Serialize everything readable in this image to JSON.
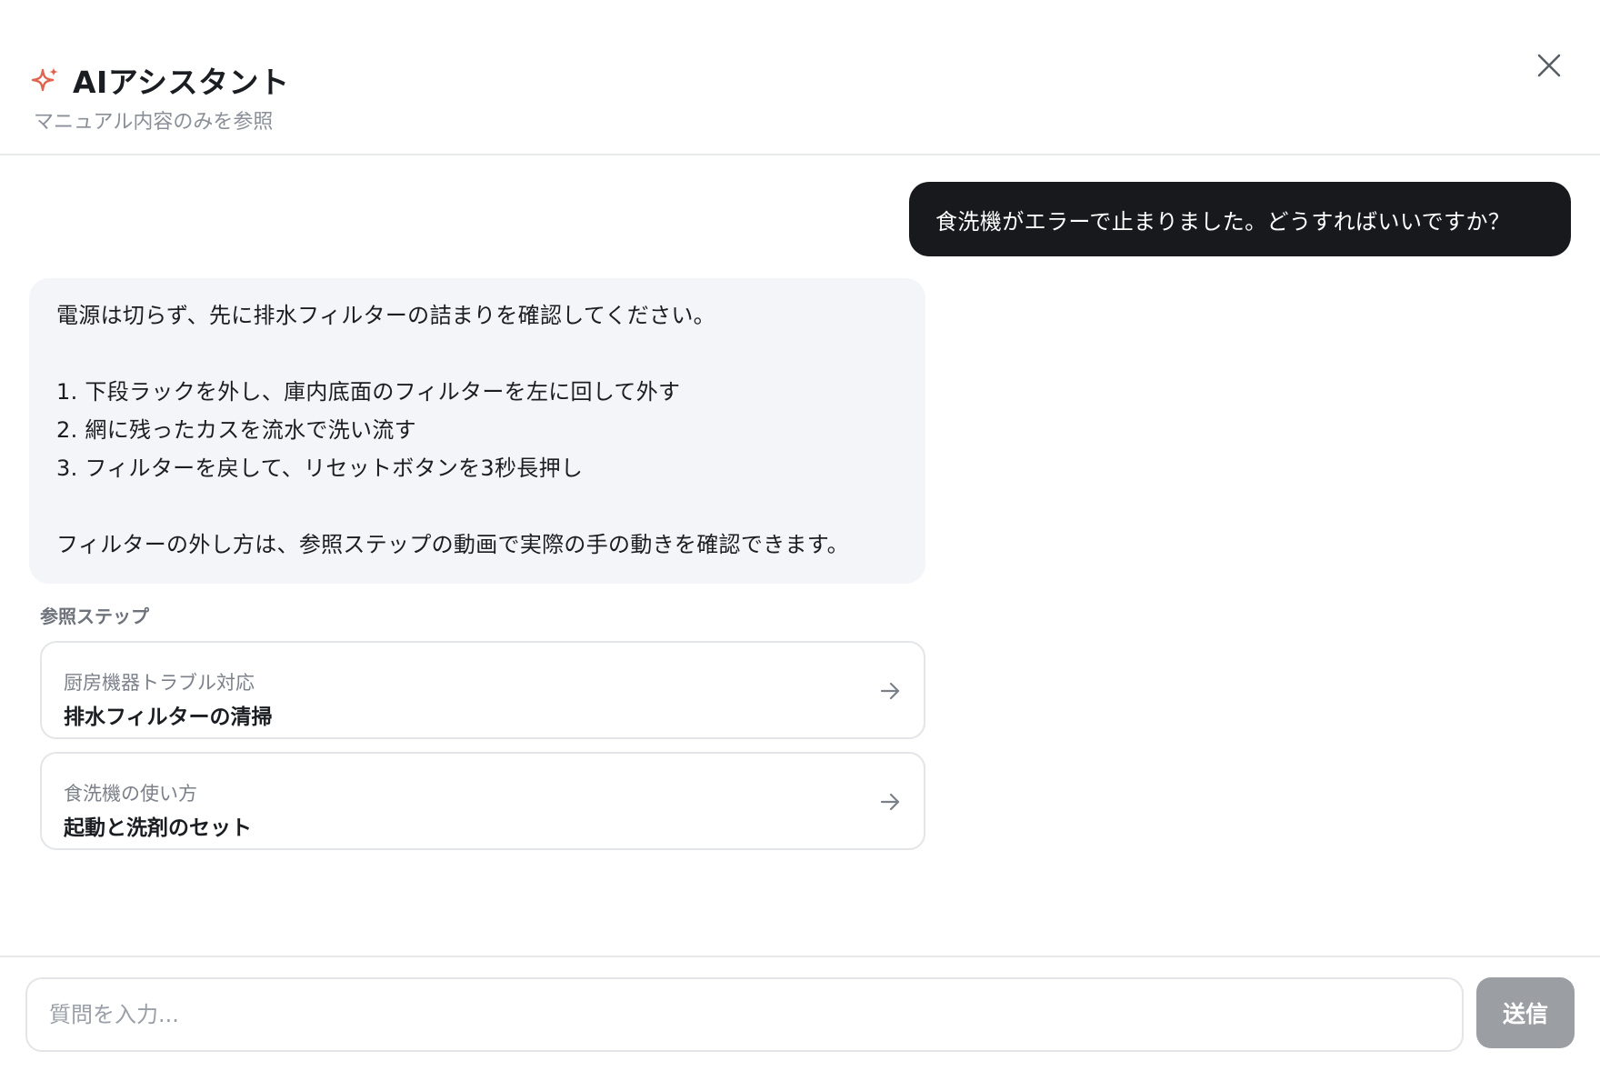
{
  "header": {
    "title": "AIアシスタント",
    "subtitle": "マニュアル内容のみを参照",
    "icon": "sparkle-icon",
    "accent_color": "#e0634f",
    "close_icon": "close-icon"
  },
  "messages": {
    "user": "食洗機がエラーで止まりました。どうすればいいですか？",
    "assistant": {
      "intro": "電源は切らず、先に排水フィルターの詰まりを確認してください。",
      "steps": [
        "1. 下段ラックを外し、庫内底面のフィルターを左に回して外す",
        "2. 網に残ったカスを流水で洗い流す",
        "3. フィルターを戻して、リセットボタンを3秒長押し"
      ],
      "outro": "フィルターの外し方は、参照ステップの動画で実際の手の動きを確認できます。"
    }
  },
  "references": {
    "label": "参照ステップ",
    "items": [
      {
        "category": "厨房機器トラブル対応",
        "title": "排水フィルターの清掃"
      },
      {
        "category": "食洗機の使い方",
        "title": "起動と洗剤のセット"
      }
    ]
  },
  "input": {
    "placeholder": "質問を入力...",
    "value": "",
    "send_label": "送信"
  },
  "colors": {
    "user_bubble": "#17191c",
    "assistant_bubble": "#f4f5f8",
    "send_button": "#9b9ea3"
  }
}
